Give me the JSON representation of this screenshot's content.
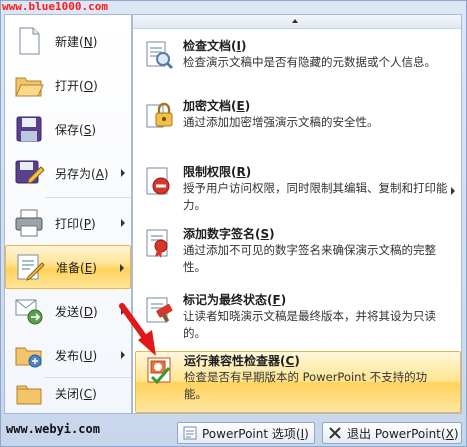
{
  "watermark_top": "www.blue1000.com",
  "watermark_bottom": "www.webyi.com",
  "left_menu": {
    "items": [
      {
        "label": "新建",
        "key": "N"
      },
      {
        "label": "打开",
        "key": "O"
      },
      {
        "label": "保存",
        "key": "S"
      },
      {
        "label": "另存为",
        "key": "A"
      },
      {
        "label": "打印",
        "key": "P"
      },
      {
        "label": "准备",
        "key": "E"
      },
      {
        "label": "发送",
        "key": "D"
      },
      {
        "label": "发布",
        "key": "U"
      },
      {
        "label": "关闭",
        "key": "C"
      }
    ]
  },
  "right_menu": {
    "items": [
      {
        "title": "检查文档",
        "key": "I",
        "desc": "检查演示文稿中是否有隐藏的元数据或个人信息。"
      },
      {
        "title": "加密文档",
        "key": "E",
        "desc": "通过添加加密增强演示文稿的安全性。"
      },
      {
        "title": "限制权限",
        "key": "R",
        "desc": "授予用户访问权限，同时限制其编辑、复制和打印能力。"
      },
      {
        "title": "添加数字签名",
        "key": "S",
        "desc": "通过添加不可见的数字签名来确保演示文稿的完整性。"
      },
      {
        "title": "标记为最终状态",
        "key": "F",
        "desc": "让读者知晓演示文稿是最终版本，并将其设为只读的。"
      },
      {
        "title": "运行兼容性检查器",
        "key": "C",
        "desc": "检查是否有早期版本的 PowerPoint 不支持的功能。"
      }
    ]
  },
  "bottom": {
    "options_label": "PowerPoint 选项",
    "options_key": "I",
    "exit_label": "退出 PowerPoint",
    "exit_key": "X"
  }
}
